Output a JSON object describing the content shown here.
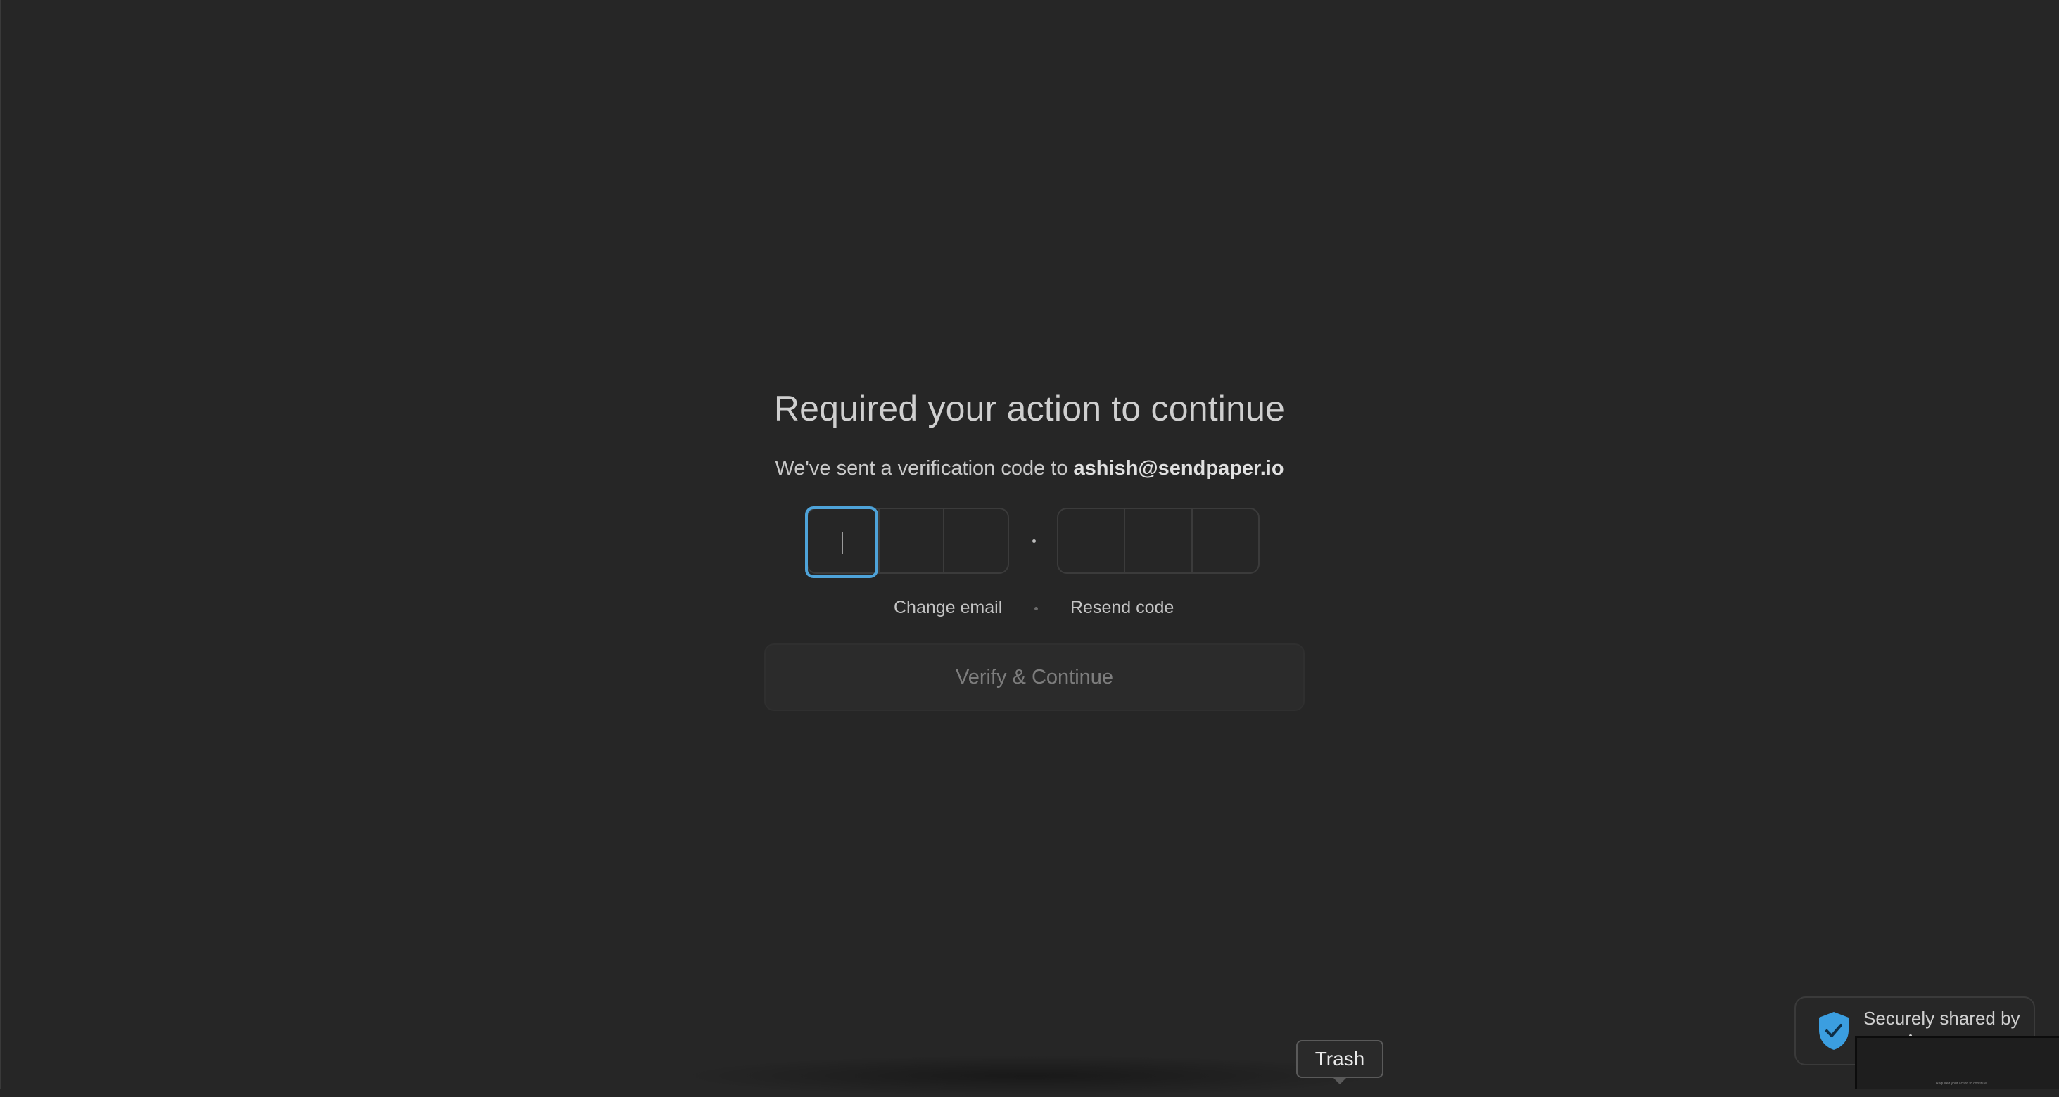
{
  "page": {
    "title": "Required your action to continue",
    "subtitle_prefix": "We've sent a verification code to ",
    "email": "ashish@sendpaper.io"
  },
  "code_input": {
    "digits": [
      "",
      "",
      "",
      "",
      "",
      ""
    ]
  },
  "links": {
    "change_email": "Change email",
    "resend_code": "Resend code"
  },
  "actions": {
    "verify_label": "Verify & Continue"
  },
  "dock": {
    "tooltip": "Trash"
  },
  "badge": {
    "text": "Securely shared by",
    "icon": "shield-check-icon",
    "accent": "#3b9ee0"
  },
  "thumbnail": {
    "title": "Required your action to continue"
  },
  "colors": {
    "background": "#262626",
    "focus": "#4ea3d9"
  }
}
